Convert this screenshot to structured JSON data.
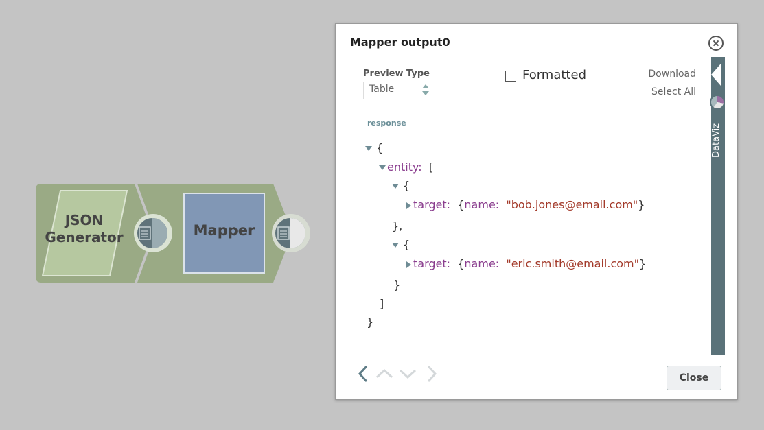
{
  "pipeline": {
    "snaps": [
      {
        "label_line1": "JSON",
        "label_line2": "Generator"
      },
      {
        "label": "Mapper"
      }
    ]
  },
  "dialog": {
    "title": "Mapper output0",
    "preview_type_label": "Preview Type",
    "preview_type_value": "Table",
    "formatted_label": "Formatted",
    "formatted_checked": false,
    "download_label": "Download",
    "select_all_label": "Select All",
    "response_label": "response",
    "dataviz_label": "DataViz",
    "close_label": "Close"
  },
  "json": {
    "open_brace": "{",
    "entity_key": "entity:",
    "entity_open": "[",
    "items": [
      {
        "open": "{",
        "target_key": "target:",
        "name_key": "name:",
        "value": "\"bob.jones@email.com\"",
        "close": "},"
      },
      {
        "open": "{",
        "target_key": "target:",
        "name_key": "name:",
        "value": "\"eric.smith@email.com\"",
        "close": "}"
      }
    ],
    "entity_close": "]",
    "close_brace": "}"
  },
  "colors": {
    "canvas_bg": "#c4c4c4",
    "pipeline_green": "#9aaa85",
    "mapper_blue": "#8197b5",
    "dataviz_bar": "#5a7279",
    "json_key": "#8a3d8e",
    "json_string": "#a33a2a"
  }
}
